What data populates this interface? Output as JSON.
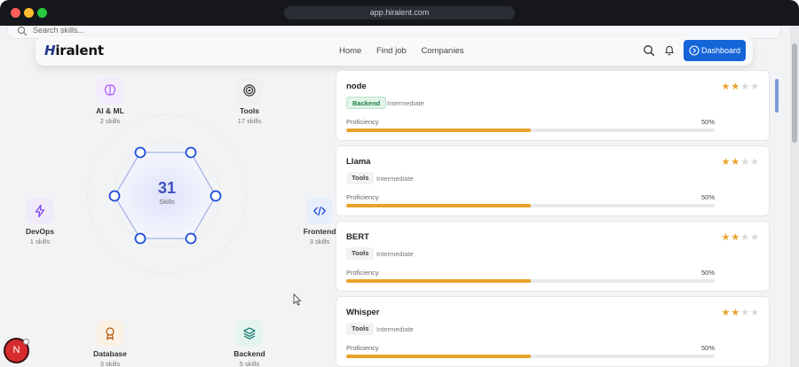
{
  "browser": {
    "url": "app.hiralent.com"
  },
  "search": {
    "placeholder": "Search skills..."
  },
  "navbar": {
    "logo": "Hiralent",
    "links": [
      "Home",
      "Find job",
      "Companies"
    ],
    "dashboard_label": "Dashboard"
  },
  "hub": {
    "total": "31",
    "total_label": "Skills",
    "categories": [
      {
        "name": "AI & ML",
        "count": "2 skills",
        "icon": "brain-icon",
        "color": "#a855f7"
      },
      {
        "name": "Tools",
        "count": "17 skills",
        "icon": "target-icon",
        "color": "#333333"
      },
      {
        "name": "DevOps",
        "count": "1 skills",
        "icon": "lightning-icon",
        "color": "#7c3aed"
      },
      {
        "name": "Frontend",
        "count": "3 skills",
        "icon": "code-icon",
        "color": "#1d4ed8"
      },
      {
        "name": "Database",
        "count": "3 skills",
        "icon": "award-icon",
        "color": "#b45309"
      },
      {
        "name": "Backend",
        "count": "5 skills",
        "icon": "layers-icon",
        "color": "#0f766e"
      }
    ]
  },
  "skills": [
    {
      "name": "node",
      "tag": "Backend",
      "level": "Intermediate",
      "proficiency_label": "Proficiency",
      "proficiency": "50%",
      "stars": 2
    },
    {
      "name": "Llama",
      "tag": "Tools",
      "level": "Intermediate",
      "proficiency_label": "Proficiency",
      "proficiency": "50%",
      "stars": 2
    },
    {
      "name": "BERT",
      "tag": "Tools",
      "level": "Intermediate",
      "proficiency_label": "Proficiency",
      "proficiency": "50%",
      "stars": 2
    },
    {
      "name": "Whisper",
      "tag": "Tools",
      "level": "Intermediate",
      "proficiency_label": "Proficiency",
      "proficiency": "50%",
      "stars": 2
    }
  ],
  "dev_badge": {
    "label": "N"
  },
  "colors": {
    "accent": "#1565d8",
    "star": "#e9a22a",
    "hub": "#3f4fbf"
  }
}
